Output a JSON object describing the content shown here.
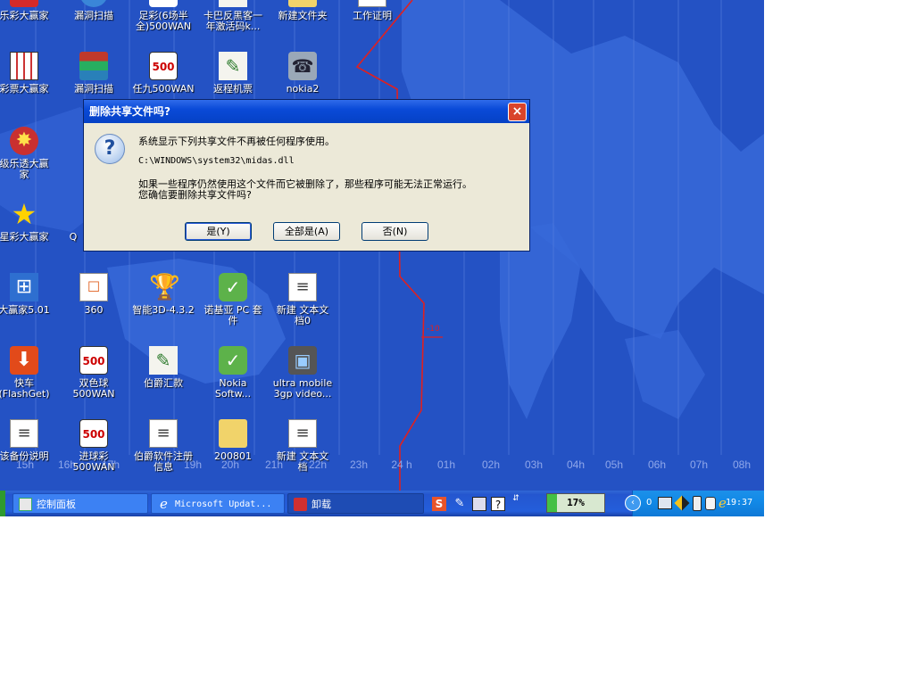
{
  "desktop": {
    "timezone_labels": [
      "15h",
      "16h",
      "17h",
      "19h",
      "20h",
      "21h",
      "22h",
      "23h",
      "24 h",
      "01h",
      "02h",
      "03h",
      "04h",
      "05h",
      "06h",
      "07h",
      "08h"
    ],
    "dateline_marker": "-10",
    "icons": [
      {
        "label": "乐彩大赢家",
        "glyph": "★"
      },
      {
        "label": "漏洞扫描",
        "glyph": "⚙"
      },
      {
        "label": "足彩(6场半\n全)500WAN",
        "glyph": "500"
      },
      {
        "label": "卡巴反黑客一\n年激活码k...",
        "glyph": "✎"
      },
      {
        "label": "新建文件夹",
        "glyph": "📁"
      },
      {
        "label": "工作证明",
        "glyph": "📄"
      },
      {
        "label": "彩票大赢家",
        "glyph": "▦"
      },
      {
        "label": "漏洞扫描",
        "glyph": "▤"
      },
      {
        "label": "任九500WAN",
        "glyph": "500"
      },
      {
        "label": "返程机票",
        "glyph": "✎"
      },
      {
        "label": "nokia2",
        "glyph": "☎"
      },
      {
        "label": "级乐透大赢\n家",
        "glyph": "✸"
      },
      {
        "label": "星彩大赢家",
        "glyph": "★"
      },
      {
        "label": "Q",
        "glyph": ""
      },
      {
        "label": "大赢家5.01",
        "glyph": "⊞"
      },
      {
        "label": "360",
        "glyph": "☐"
      },
      {
        "label": "智能3D-4.3.2",
        "glyph": "🏆"
      },
      {
        "label": "诺基亚 PC 套\n件",
        "glyph": "✓"
      },
      {
        "label": "新建 文本文\n档0",
        "glyph": "≡"
      },
      {
        "label": "快车\n(FlashGet)",
        "glyph": "⬇"
      },
      {
        "label": "双色球500WAN",
        "glyph": "500"
      },
      {
        "label": "伯爵汇款",
        "glyph": "✎"
      },
      {
        "label": "Nokia\nSoftw...",
        "glyph": "✓"
      },
      {
        "label": "ultra mobile\n3gp video...",
        "glyph": "▣"
      },
      {
        "label": "该备份说明",
        "glyph": "≡"
      },
      {
        "label": "进球彩500WAN",
        "glyph": "500"
      },
      {
        "label": "伯爵软件注册\n信息",
        "glyph": "≡"
      },
      {
        "label": "200801",
        "glyph": "📁"
      },
      {
        "label": "新建 文本文\n档",
        "glyph": "≡"
      }
    ]
  },
  "dialog": {
    "title": "删除共享文件吗?",
    "close": "×",
    "line1": "系统显示下列共享文件不再被任何程序使用。",
    "path": "C:\\WINDOWS\\system32\\midas.dll",
    "line2": "如果一些程序仍然使用这个文件而它被删除了，那些程序可能无法正常运行。",
    "line3": "您确信要删除共享文件吗?",
    "buttons": {
      "yes": "是(Y)",
      "yes_to_all": "全部是(A)",
      "no": "否(N)"
    }
  },
  "taskbar": {
    "tasks": [
      {
        "label": "控制面板"
      },
      {
        "label": "Microsoft Updat..."
      },
      {
        "label": "卸载"
      }
    ],
    "battery": "17%",
    "tray_count": "0",
    "clock": "19:37"
  },
  "colors": {
    "desktop": "#2452c4",
    "taskbar": "#245edb",
    "dialog_title": "#0a4ad8",
    "dateline": "#e02020"
  }
}
